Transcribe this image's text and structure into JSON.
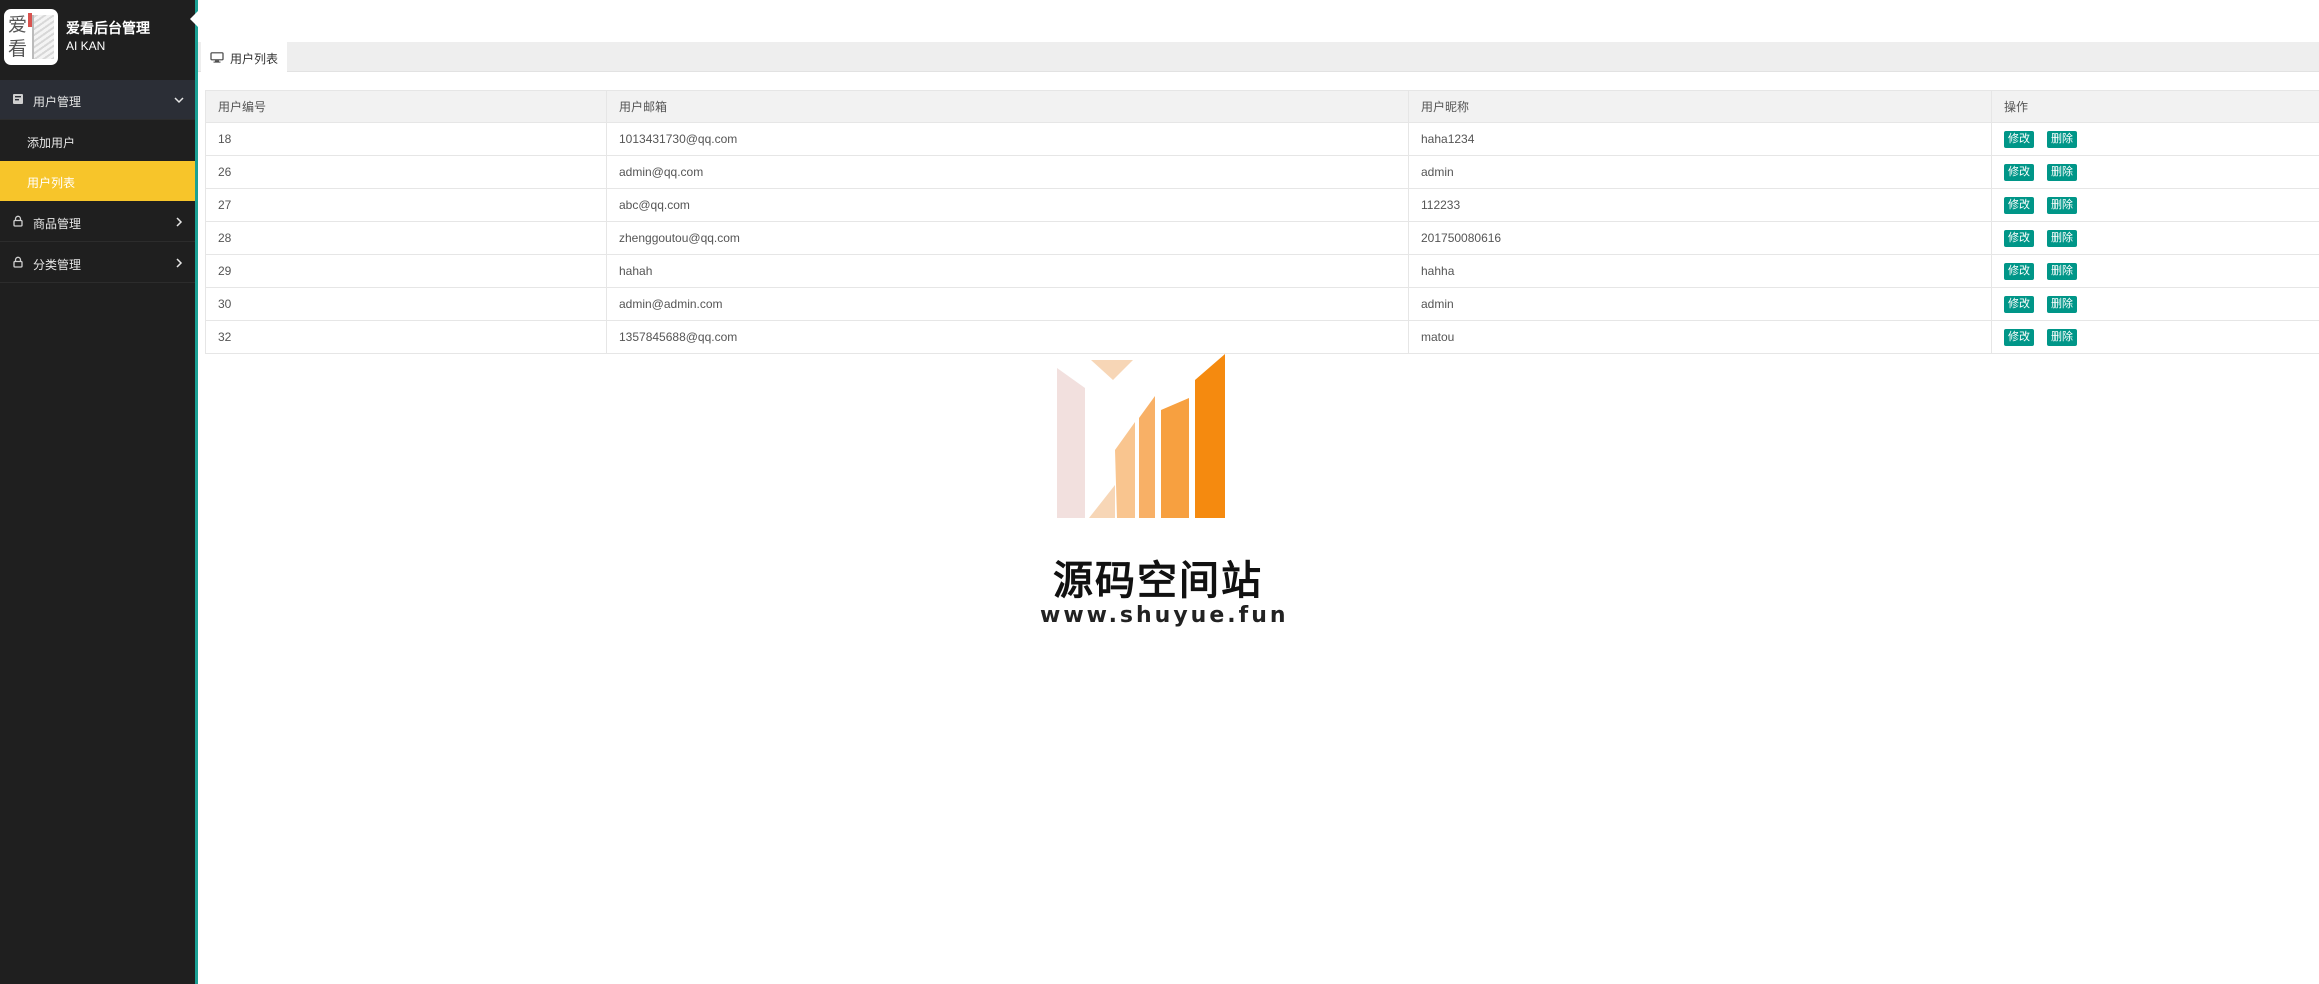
{
  "app": {
    "logo_char_1": "爱",
    "logo_char_2": "看",
    "title": "爱看后台管理",
    "subtitle": "AI KAN"
  },
  "sidebar": {
    "menus": [
      {
        "label": "用户管理",
        "icon": "book-icon",
        "expanded": true,
        "children": [
          {
            "label": "添加用户",
            "active": false
          },
          {
            "label": "用户列表",
            "active": true
          }
        ]
      },
      {
        "label": "商品管理",
        "icon": "lock-icon",
        "expanded": false
      },
      {
        "label": "分类管理",
        "icon": "lock-icon",
        "expanded": false
      }
    ]
  },
  "tabs": [
    {
      "label": "用户列表",
      "icon": "monitor-icon"
    }
  ],
  "table": {
    "columns": [
      "用户编号",
      "用户邮箱",
      "用户昵称",
      "操作"
    ],
    "rows": [
      {
        "id": "18",
        "email": "1013431730@qq.com",
        "nickname": "haha1234"
      },
      {
        "id": "26",
        "email": "admin@qq.com",
        "nickname": "admin"
      },
      {
        "id": "27",
        "email": "abc@qq.com",
        "nickname": "112233"
      },
      {
        "id": "28",
        "email": "zhenggoutou@qq.com",
        "nickname": "201750080616"
      },
      {
        "id": "29",
        "email": "hahah",
        "nickname": "hahha"
      },
      {
        "id": "30",
        "email": "admin@admin.com",
        "nickname": "admin"
      },
      {
        "id": "32",
        "email": "1357845688@qq.com",
        "nickname": "matou"
      }
    ],
    "edit_label": "修改",
    "delete_label": "删除"
  },
  "watermark": {
    "title": "源码空间站",
    "url": "www.shuyue.fun"
  },
  "colors": {
    "sidebar_bg": "#1f1f1f",
    "active_item": "#f7c52a",
    "button": "#009688",
    "accent_border": "#1aa094"
  }
}
